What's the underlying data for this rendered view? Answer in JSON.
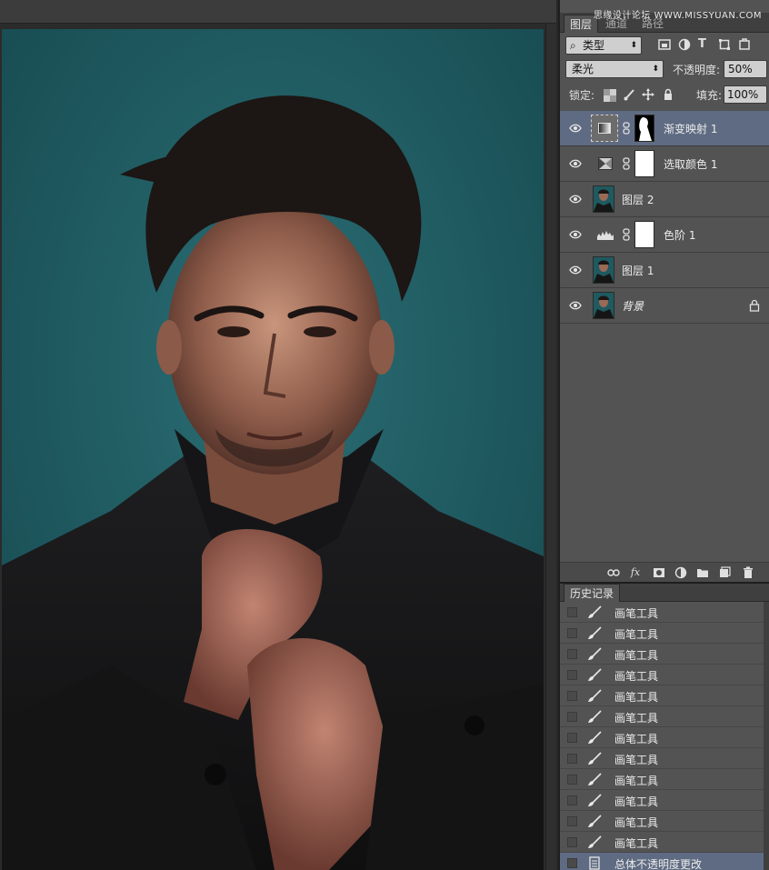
{
  "watermark": "思缘设计论坛 WWW.MISSYUAN.COM",
  "layers_panel": {
    "tabs": [
      {
        "label": "图层",
        "active": true
      },
      {
        "label": "通道",
        "active": false
      },
      {
        "label": "路径",
        "active": false
      }
    ],
    "filter_kind": "类型",
    "blend_mode": "柔光",
    "opacity_label": "不透明度:",
    "opacity_value": "50%",
    "lock_label": "锁定:",
    "fill_label": "填充:",
    "fill_value": "100%",
    "layers": [
      {
        "name": "渐变映射 1",
        "type": "gradient-map",
        "selected": true,
        "mask": "figure"
      },
      {
        "name": "选取颜色 1",
        "type": "selective-color",
        "selected": false,
        "mask": "white"
      },
      {
        "name": "图层 2",
        "type": "pixel",
        "selected": false
      },
      {
        "name": "色阶 1",
        "type": "levels",
        "selected": false,
        "mask": "white"
      },
      {
        "name": "图层 1",
        "type": "pixel",
        "selected": false
      },
      {
        "name": "背景",
        "type": "background",
        "selected": false,
        "locked": true
      }
    ],
    "footer_icons": [
      "link-icon",
      "fx-icon",
      "add-mask-icon",
      "adjustment-icon",
      "group-icon",
      "new-layer-icon",
      "delete-icon"
    ]
  },
  "history_panel": {
    "tab": "历史记录",
    "items": [
      {
        "label": "画笔工具",
        "icon": "brush-icon"
      },
      {
        "label": "画笔工具",
        "icon": "brush-icon"
      },
      {
        "label": "画笔工具",
        "icon": "brush-icon"
      },
      {
        "label": "画笔工具",
        "icon": "brush-icon"
      },
      {
        "label": "画笔工具",
        "icon": "brush-icon"
      },
      {
        "label": "画笔工具",
        "icon": "brush-icon"
      },
      {
        "label": "画笔工具",
        "icon": "brush-icon"
      },
      {
        "label": "画笔工具",
        "icon": "brush-icon"
      },
      {
        "label": "画笔工具",
        "icon": "brush-icon"
      },
      {
        "label": "画笔工具",
        "icon": "brush-icon"
      },
      {
        "label": "画笔工具",
        "icon": "brush-icon"
      },
      {
        "label": "画笔工具",
        "icon": "brush-icon"
      },
      {
        "label": "总体不透明度更改",
        "icon": "document-icon",
        "selected": true
      }
    ]
  },
  "colors": {
    "canvas_bg": "#1f5a60",
    "panel_bg": "#535353",
    "selection": "#5f6b82"
  }
}
